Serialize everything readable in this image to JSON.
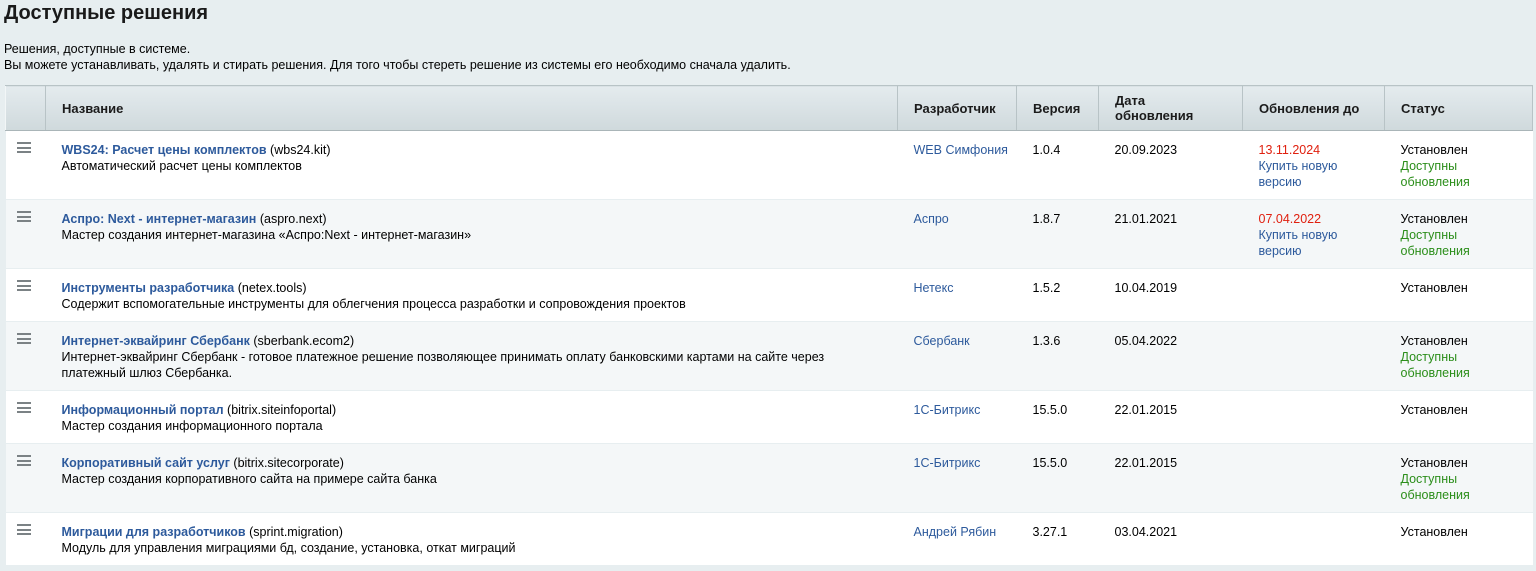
{
  "title": "Доступные решения",
  "description": {
    "line1": "Решения, доступные в системе.",
    "line2": "Вы можете устанавливать, удалять и стирать решения. Для того чтобы стереть решение из системы его необходимо сначала удалить."
  },
  "columns": {
    "name": "Название",
    "developer": "Разработчик",
    "version": "Версия",
    "date_line1": "Дата",
    "date_line2": "обновления",
    "updates_until": "Обновления до",
    "status": "Статус"
  },
  "colors": {
    "link": "#2d5a9c",
    "expired": "#e0200f",
    "updates": "#2b8e1a",
    "page_bg": "#e7eef0"
  },
  "rows": [
    {
      "name": "WBS24: Расчет цены комплектов",
      "code": "(wbs24.kit)",
      "desc1": "Автоматический расчет цены комплектов",
      "desc2": "",
      "developer": "WEB Симфония",
      "version": "1.0.4",
      "date": "20.09.2023",
      "until_date": "13.11.2024",
      "buy1": "Купить новую",
      "buy2": "версию",
      "status": "Установлен",
      "avail1": "Доступны",
      "avail2": "обновления"
    },
    {
      "name": "Аспро: Next - интернет-магазин",
      "code": "(aspro.next)",
      "desc1": "Мастер создания интернет-магазина «Аспро:Next - интернет-магазин»",
      "desc2": "",
      "developer": "Аспро",
      "version": "1.8.7",
      "date": "21.01.2021",
      "until_date": "07.04.2022",
      "buy1": "Купить новую",
      "buy2": "версию",
      "status": "Установлен",
      "avail1": "Доступны",
      "avail2": "обновления"
    },
    {
      "name": "Инструменты разработчика",
      "code": "(netex.tools)",
      "desc1": "Содержит вспомогательные инструменты для облегчения процесса разработки и сопровождения проектов",
      "desc2": "",
      "developer": "Нетекс",
      "version": "1.5.2",
      "date": "10.04.2019",
      "until_date": "",
      "buy1": "",
      "buy2": "",
      "status": "Установлен",
      "avail1": "",
      "avail2": ""
    },
    {
      "name": "Интернет-эквайринг Сбербанк",
      "code": "(sberbank.ecom2)",
      "desc1": "Интернет-эквайринг Сбербанк - готовое платежное решение позволяющее принимать оплату банковскими картами на сайте через",
      "desc2": "платежный шлюз Сбербанка.",
      "developer": "Сбербанк",
      "version": "1.3.6",
      "date": "05.04.2022",
      "until_date": "",
      "buy1": "",
      "buy2": "",
      "status": "Установлен",
      "avail1": "Доступны",
      "avail2": "обновления"
    },
    {
      "name": "Информационный портал",
      "code": "(bitrix.siteinfoportal)",
      "desc1": "Мастер создания информационного портала",
      "desc2": "",
      "developer": "1С-Битрикс",
      "version": "15.5.0",
      "date": "22.01.2015",
      "until_date": "",
      "buy1": "",
      "buy2": "",
      "status": "Установлен",
      "avail1": "",
      "avail2": ""
    },
    {
      "name": "Корпоративный сайт услуг",
      "code": "(bitrix.sitecorporate)",
      "desc1": "Мастер создания корпоративного сайта на примере сайта банка",
      "desc2": "",
      "developer": "1С-Битрикс",
      "version": "15.5.0",
      "date": "22.01.2015",
      "until_date": "",
      "buy1": "",
      "buy2": "",
      "status": "Установлен",
      "avail1": "Доступны",
      "avail2": "обновления"
    },
    {
      "name": "Миграции для разработчиков",
      "code": "(sprint.migration)",
      "desc1": "Модуль для управления миграциями бд, создание, установка, откат миграций",
      "desc2": "",
      "developer": "Андрей Рябин",
      "version": "3.27.1",
      "date": "03.04.2021",
      "until_date": "",
      "buy1": "",
      "buy2": "",
      "status": "Установлен",
      "avail1": "",
      "avail2": ""
    }
  ]
}
